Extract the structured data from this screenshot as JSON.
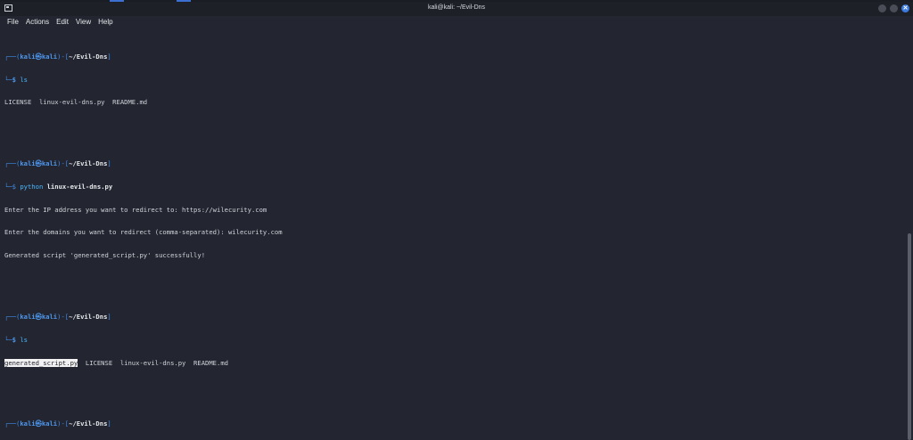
{
  "window": {
    "title": "kali@kali: ~/Evil-Dns",
    "controls": [
      "minimize",
      "maximize",
      "close"
    ],
    "close_glyph": "✕"
  },
  "menu": {
    "file": "File",
    "actions": "Actions",
    "edit": "Edit",
    "view": "View",
    "help": "Help"
  },
  "colors": {
    "background": "#232630",
    "prompt_blue": "#3f8ce8",
    "highlight_bg": "#f2f2f2"
  },
  "prompt": {
    "top_prefix": "┌──(",
    "user": "kali",
    "at": "㉿",
    "host": "kali",
    "mid": ")-[",
    "path": "~/Evil-Dns",
    "end": "]",
    "bottom_prefix": "└─",
    "dollar": "$",
    "venv_prefix": "└─$ ",
    "venv": "python"
  },
  "session": {
    "cmd1": "ls",
    "out1": "LICENSE  linux-evil-dns.py  README.md",
    "cmd2": "linux-evil-dns.py",
    "out2_line1": "Enter the IP address you want to redirect to: https://wilecurity.com",
    "out2_line2": "Enter the domains you want to redirect (comma-separated): wilecurity.com",
    "out2_line3": "Generated script 'generated_script.py' successfully!",
    "cmd3": "ls",
    "out3_highlight": "generated_script.py",
    "out3_rest": "  LICENSE  linux-evil-dns.py  README.md"
  }
}
